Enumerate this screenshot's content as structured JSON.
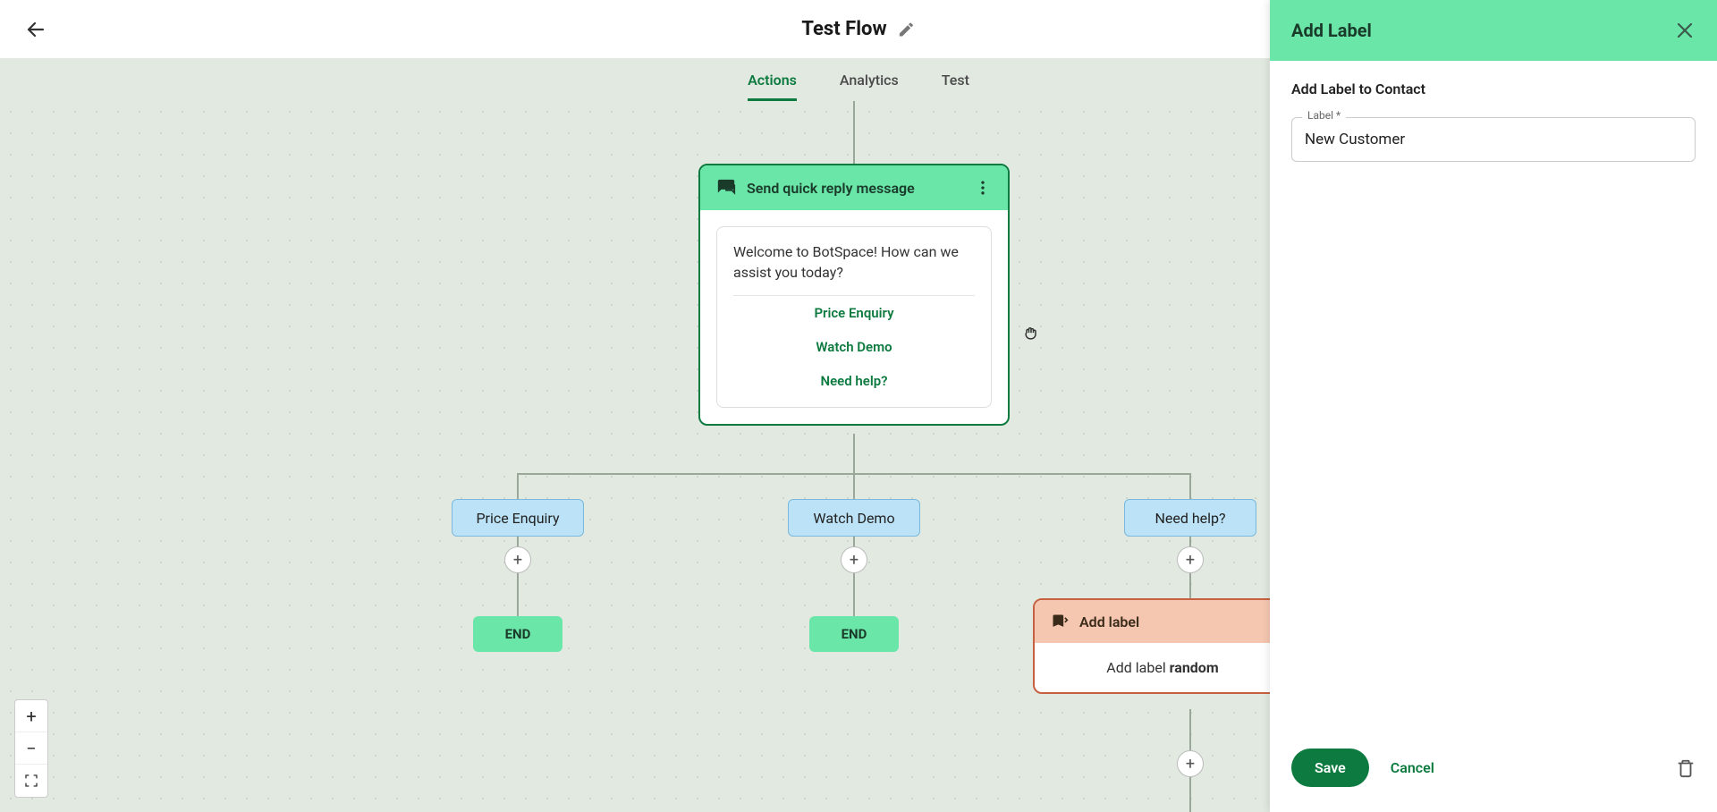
{
  "header": {
    "title": "Test Flow"
  },
  "tabs": {
    "actions": "Actions",
    "analytics": "Analytics",
    "test": "Test"
  },
  "flow": {
    "msg_card": {
      "title": "Send quick reply message",
      "text": "Welcome to BotSpace! How can we assist you today?",
      "options": [
        "Price Enquiry",
        "Watch Demo",
        "Need help?"
      ]
    },
    "branches": [
      "Price Enquiry",
      "Watch Demo",
      "Need help?"
    ],
    "end": "END",
    "label_card": {
      "title": "Add label",
      "body_prefix": "Add label ",
      "body_value": "random"
    }
  },
  "panel": {
    "title": "Add Label",
    "subtitle": "Add Label to Contact",
    "field_label": "Label *",
    "field_value": "New Customer",
    "save": "Save",
    "cancel": "Cancel"
  }
}
